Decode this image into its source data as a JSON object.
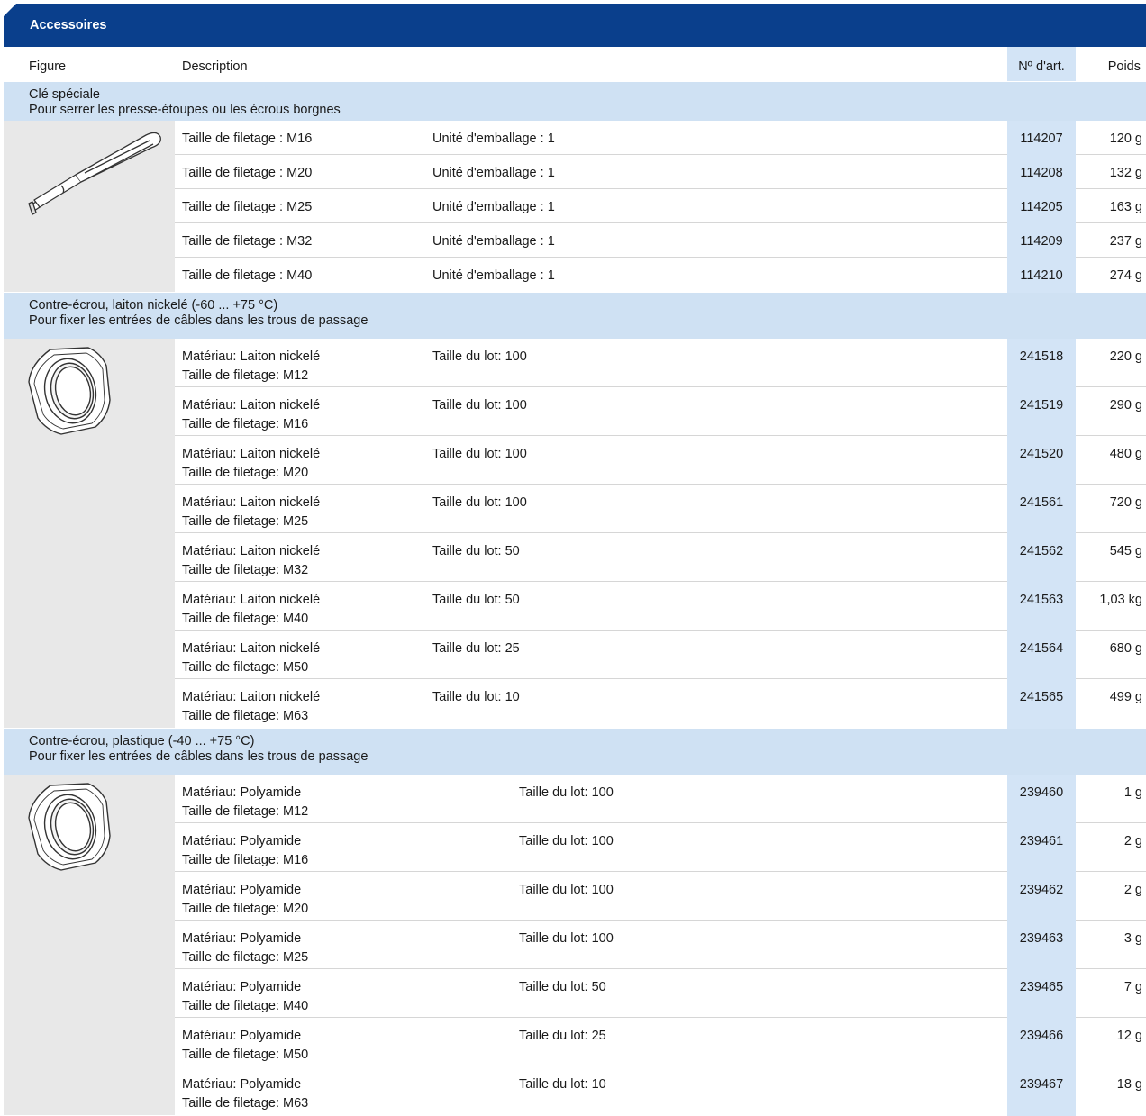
{
  "section_title": "Accessoires",
  "columns": {
    "figure": "Figure",
    "description": "Description",
    "article": "Nº d'art.",
    "weight": "Poids"
  },
  "groups": [
    {
      "title": "Clé spéciale",
      "subtitle": "Pour serrer les presse-étoupes ou les écrous borgnes",
      "figure_icon": "special-wrench-icon",
      "rows": [
        {
          "desc1": "Taille de filetage : M16",
          "desc2": "Unité d'emballage : 1",
          "article": "114207",
          "weight": "120 g"
        },
        {
          "desc1": "Taille de filetage : M20",
          "desc2": "Unité d'emballage : 1",
          "article": "114208",
          "weight": "132 g"
        },
        {
          "desc1": "Taille de filetage : M25",
          "desc2": "Unité d'emballage : 1",
          "article": "114205",
          "weight": "163 g"
        },
        {
          "desc1": "Taille de filetage : M32",
          "desc2": "Unité d'emballage : 1",
          "article": "114209",
          "weight": "237 g"
        },
        {
          "desc1": "Taille de filetage : M40",
          "desc2": "Unité d'emballage : 1",
          "article": "114210",
          "weight": "274 g"
        }
      ]
    },
    {
      "title": "Contre-écrou, laiton nickelé (-60 ... +75 °C)",
      "subtitle": "Pour fixer les entrées de câbles dans les trous de passage",
      "figure_icon": "hex-locknut-icon",
      "rows": [
        {
          "desc1": "Matériau: Laiton nickelé",
          "desc1b": "Taille de filetage: M12",
          "desc2": "Taille du lot: 100",
          "article": "241518",
          "weight": "220 g"
        },
        {
          "desc1": "Matériau: Laiton nickelé",
          "desc1b": "Taille de filetage: M16",
          "desc2": "Taille du lot: 100",
          "article": "241519",
          "weight": "290 g"
        },
        {
          "desc1": "Matériau: Laiton nickelé",
          "desc1b": "Taille de filetage: M20",
          "desc2": "Taille du lot: 100",
          "article": "241520",
          "weight": "480 g"
        },
        {
          "desc1": "Matériau: Laiton nickelé",
          "desc1b": "Taille de filetage: M25",
          "desc2": "Taille du lot: 100",
          "article": "241561",
          "weight": "720 g"
        },
        {
          "desc1": "Matériau: Laiton nickelé",
          "desc1b": "Taille de filetage: M32",
          "desc2": "Taille du lot: 50",
          "article": "241562",
          "weight": "545 g"
        },
        {
          "desc1": "Matériau: Laiton nickelé",
          "desc1b": "Taille de filetage: M40",
          "desc2": "Taille du lot: 50",
          "article": "241563",
          "weight": "1,03 kg"
        },
        {
          "desc1": "Matériau: Laiton nickelé",
          "desc1b": "Taille de filetage: M50",
          "desc2": "Taille du lot: 25",
          "article": "241564",
          "weight": "680 g"
        },
        {
          "desc1": "Matériau: Laiton nickelé",
          "desc1b": "Taille de filetage: M63",
          "desc2": "Taille du lot: 10",
          "article": "241565",
          "weight": "499 g"
        }
      ]
    },
    {
      "title": "Contre-écrou, plastique (-40 ... +75 °C)",
      "subtitle": "Pour fixer les entrées de câbles dans les trous de passage",
      "figure_icon": "hex-locknut-icon",
      "rows": [
        {
          "desc1": "Matériau: Polyamide",
          "desc1b": "Taille de filetage: M12",
          "desc2": "Taille du lot: 100",
          "article": "239460",
          "weight": "1 g"
        },
        {
          "desc1": "Matériau: Polyamide",
          "desc1b": "Taille de filetage: M16",
          "desc2": "Taille du lot: 100",
          "article": "239461",
          "weight": "2 g"
        },
        {
          "desc1": "Matériau: Polyamide",
          "desc1b": "Taille de filetage: M20",
          "desc2": "Taille du lot: 100",
          "article": "239462",
          "weight": "2 g"
        },
        {
          "desc1": "Matériau: Polyamide",
          "desc1b": "Taille de filetage: M25",
          "desc2": "Taille du lot: 100",
          "article": "239463",
          "weight": "3 g"
        },
        {
          "desc1": "Matériau: Polyamide",
          "desc1b": "Taille de filetage: M40",
          "desc2": "Taille du lot: 50",
          "article": "239465",
          "weight": "7 g"
        },
        {
          "desc1": "Matériau: Polyamide",
          "desc1b": "Taille de filetage: M50",
          "desc2": "Taille du lot: 25",
          "article": "239466",
          "weight": "12 g"
        },
        {
          "desc1": "Matériau: Polyamide",
          "desc1b": "Taille de filetage: M63",
          "desc2": "Taille du lot: 10",
          "article": "239467",
          "weight": "18 g"
        }
      ]
    }
  ]
}
